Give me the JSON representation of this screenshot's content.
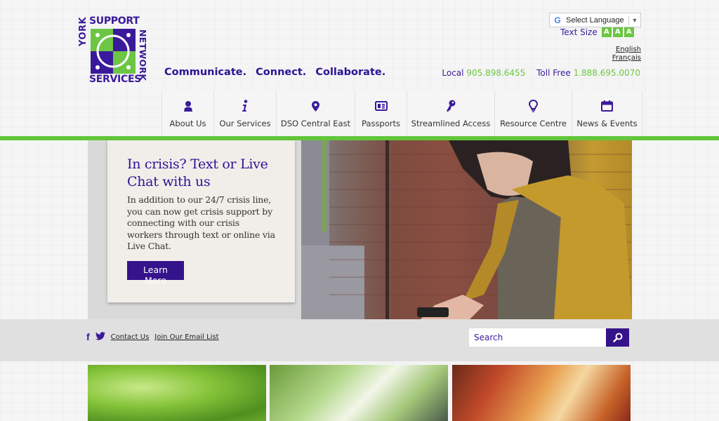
{
  "brand": {
    "logo_top": "SUPPORT",
    "logo_bottom": "SERVICES",
    "logo_left": "YORK",
    "logo_right": "NETWORK",
    "colors": {
      "purple": "#3a1a9a",
      "green": "#6cc644",
      "dark_purple": "#35138a"
    }
  },
  "tagline": [
    "Communicate.",
    "Connect.",
    "Collaborate."
  ],
  "language": {
    "select_label": "Select Language",
    "google_icon": "G",
    "links": [
      "English",
      "Français"
    ]
  },
  "text_size": {
    "label": "Text Size",
    "buttons": [
      "A",
      "A",
      "A"
    ]
  },
  "phones": {
    "local_label": "Local",
    "local_number": "905.898.6455",
    "tollfree_label": "Toll Free",
    "tollfree_number": "1.888.695.0070"
  },
  "nav": [
    {
      "label": "About Us",
      "icon": "person-icon"
    },
    {
      "label": "Our Services",
      "icon": "info-icon"
    },
    {
      "label": "DSO Central East",
      "icon": "map-pin-icon"
    },
    {
      "label": "Passports",
      "icon": "id-card-icon"
    },
    {
      "label": "Streamlined Access",
      "icon": "key-icon"
    },
    {
      "label": "Resource Centre",
      "icon": "lightbulb-icon"
    },
    {
      "label": "News & Events",
      "icon": "calendar-icon"
    }
  ],
  "hero": {
    "title": "In crisis? Text or Live Chat with us",
    "body": "In addition to our 24/7 crisis line, you can now get crisis support by connecting with our crisis workers through text or online via Live Chat.",
    "button": "Learn More"
  },
  "footer": {
    "facebook_icon": "f",
    "links": [
      "Contact Us",
      "Join Our Email List"
    ],
    "search_placeholder": "Search"
  }
}
